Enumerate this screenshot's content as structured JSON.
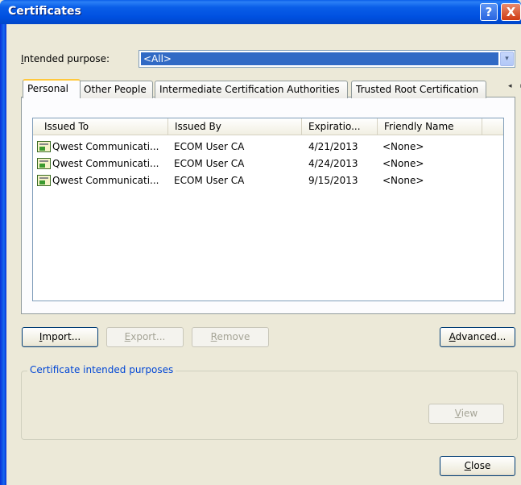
{
  "window": {
    "title": "Certificates",
    "help_symbol": "?",
    "close_symbol": "X"
  },
  "purpose": {
    "label_prefix": "I",
    "label_rest": "ntended purpose:",
    "value": "<All>",
    "arrow": "▾"
  },
  "tabs": [
    {
      "label": "Personal",
      "active": true
    },
    {
      "label": "Other People",
      "active": false
    },
    {
      "label": "Intermediate Certification Authorities",
      "active": false
    },
    {
      "label": "Trusted Root Certification",
      "active": false
    }
  ],
  "tab_scroll": "◂ ▸",
  "list": {
    "columns": [
      "Issued To",
      "Issued By",
      "Expiratio...",
      "Friendly Name"
    ],
    "rows": [
      {
        "issued_to": "Qwest Communicati...",
        "issued_by": "ECOM User CA",
        "expiration": "4/21/2013",
        "friendly_name": "<None>"
      },
      {
        "issued_to": "Qwest Communicati...",
        "issued_by": "ECOM User CA",
        "expiration": "4/24/2013",
        "friendly_name": "<None>"
      },
      {
        "issued_to": "Qwest Communicati...",
        "issued_by": "ECOM User CA",
        "expiration": "9/15/2013",
        "friendly_name": "<None>"
      }
    ]
  },
  "buttons": {
    "import": {
      "mnemonic": "I",
      "rest": "mport..."
    },
    "export": {
      "mnemonic": "E",
      "rest": "xport..."
    },
    "remove": {
      "mnemonic": "R",
      "rest": "emove"
    },
    "advanced": {
      "mnemonic": "A",
      "rest": "dvanced..."
    },
    "view": {
      "mnemonic": "V",
      "rest": "iew"
    },
    "close": {
      "mnemonic": "C",
      "rest": "lose"
    }
  },
  "group": {
    "title": "Certificate intended purposes"
  },
  "colors": {
    "titlebar": "#0a5ee8",
    "selection": "#316ac5",
    "group_title": "#0046d5",
    "tab_highlight": "#ffc83c"
  }
}
